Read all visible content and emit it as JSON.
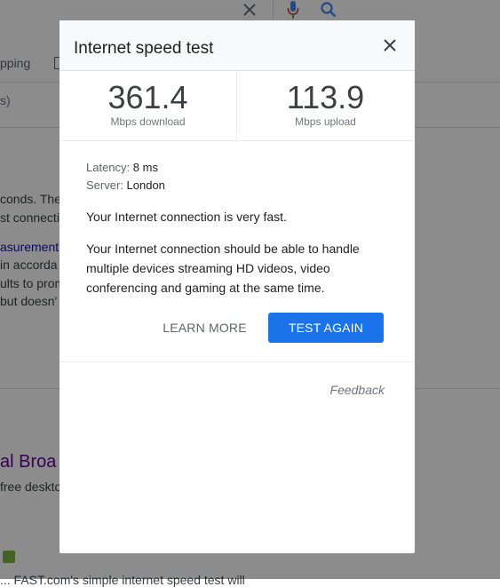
{
  "background": {
    "tabs": {
      "shopping_partial": "pping"
    },
    "results_count_partial": "s)",
    "snippet_lines": [
      "conds. The",
      "st connecti",
      "asurement",
      " in accorda",
      "ults to prom",
      " but doesn'"
    ],
    "result_title_partial": "al Broa",
    "result_snippet_partial": "free deskto",
    "bottom_snippet_partial": "... FAST.com's simple internet speed test will"
  },
  "dialog": {
    "title": "Internet speed test",
    "download": {
      "value": "361.4",
      "label": "Mbps download"
    },
    "upload": {
      "value": "113.9",
      "label": "Mbps upload"
    },
    "latency": {
      "key": "Latency:",
      "value": "8 ms"
    },
    "server": {
      "key": "Server:",
      "value": "London"
    },
    "summary": "Your Internet connection is very fast.",
    "description": "Your Internet connection should be able to handle multiple devices streaming HD videos, video conferencing and gaming at the same time.",
    "learn_more_label": "LEARN MORE",
    "test_again_label": "TEST AGAIN",
    "feedback_label": "Feedback"
  },
  "colors": {
    "accent": "#1a73e8",
    "mic_red": "#ea4335",
    "search_blue": "#4285f4",
    "visited_link": "#660099"
  }
}
